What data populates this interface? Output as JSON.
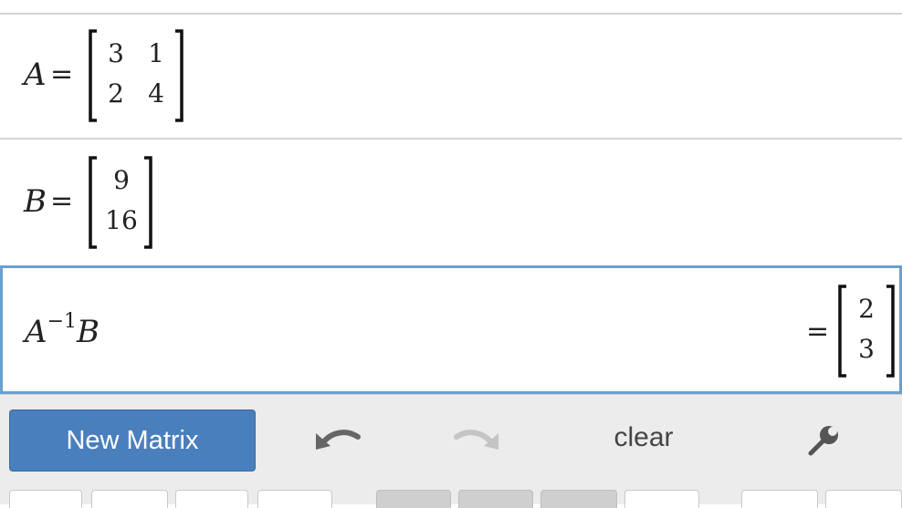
{
  "expressions": [
    {
      "variable": "A",
      "equals": "=",
      "matrix": [
        [
          "3",
          "1"
        ],
        [
          "2",
          "4"
        ]
      ]
    },
    {
      "variable": "B",
      "equals": "=",
      "matrix": [
        [
          "9"
        ],
        [
          "16"
        ]
      ]
    },
    {
      "expression_base": "A",
      "expression_exponent": "−1",
      "expression_rest": "B",
      "equals": "=",
      "result": [
        [
          "2"
        ],
        [
          "3"
        ]
      ]
    }
  ],
  "toolbar": {
    "new_matrix_label": "New Matrix",
    "clear_label": "clear",
    "undo_icon": "undo-icon",
    "redo_icon": "redo-icon",
    "settings_icon": "wrench-icon"
  },
  "colors": {
    "accent": "#4a7fbd",
    "active_border": "#6a9fd0"
  }
}
